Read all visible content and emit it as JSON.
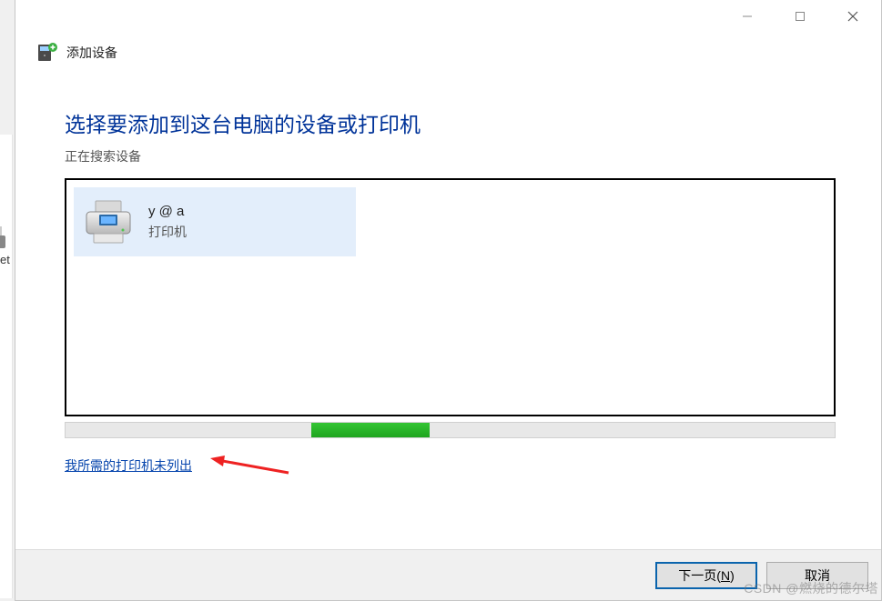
{
  "header": {
    "title": "添加设备"
  },
  "main": {
    "heading": "选择要添加到这台电脑的设备或打印机",
    "subheading": "正在搜索设备"
  },
  "devices": [
    {
      "name": "y @ a",
      "type": "打印机"
    }
  ],
  "link": {
    "not_listed": "我所需的打印机未列出"
  },
  "buttons": {
    "next_prefix": "下一页(",
    "next_accel": "N",
    "next_suffix": ")",
    "cancel": "取消"
  },
  "watermark": "CSDN @燃烧的德尔塔",
  "bg": {
    "side_label": "et"
  }
}
